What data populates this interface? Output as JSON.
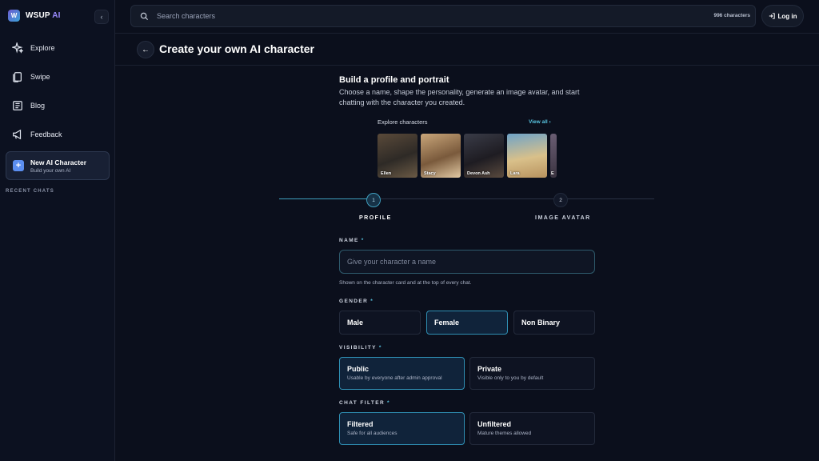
{
  "app": {
    "name": "WSUP",
    "name_accent": "AI",
    "logo_letter": "W"
  },
  "sidebar": {
    "items": [
      {
        "label": "Explore",
        "icon": "sparkle-icon"
      },
      {
        "label": "Swipe",
        "icon": "cards-icon"
      },
      {
        "label": "Blog",
        "icon": "newspaper-icon"
      },
      {
        "label": "Feedback",
        "icon": "megaphone-icon"
      }
    ],
    "new_character": {
      "title": "New AI Character",
      "subtitle": "Build your own AI"
    },
    "recent_chats_label": "RECENT CHATS"
  },
  "search": {
    "placeholder": "Search characters",
    "count": "996 characters"
  },
  "login": {
    "label": "Log in"
  },
  "page": {
    "title": "Create your own AI character"
  },
  "intro": {
    "title": "Build a profile and portrait",
    "description": "Choose a name, shape the personality, generate an image avatar, and start chatting with the character you created."
  },
  "explore": {
    "label": "Explore characters",
    "view_all": "View all",
    "characters": [
      "Ellen",
      "Stacy",
      "Devon Ash",
      "Lara",
      "E"
    ]
  },
  "steps": [
    {
      "number": "1",
      "label": "PROFILE",
      "active": true
    },
    {
      "number": "2",
      "label": "IMAGE AVATAR",
      "active": false
    }
  ],
  "form": {
    "name": {
      "label": "NAME",
      "required": "*",
      "placeholder": "Give your character a name",
      "hint": "Shown on the character card and at the top of every chat."
    },
    "gender": {
      "label": "GENDER",
      "required": "*",
      "options": [
        "Male",
        "Female",
        "Non Binary"
      ],
      "selected": "Female"
    },
    "visibility": {
      "label": "VISIBILITY",
      "required": "*",
      "options": [
        {
          "title": "Public",
          "subtitle": "Usable by everyone after admin approval"
        },
        {
          "title": "Private",
          "subtitle": "Visible only to you by default"
        }
      ],
      "selected": "Public"
    },
    "chat_filter": {
      "label": "CHAT FILTER",
      "required": "*",
      "options": [
        {
          "title": "Filtered",
          "subtitle": "Safe for all audiences"
        },
        {
          "title": "Unfiltered",
          "subtitle": "Mature themes allowed"
        }
      ],
      "selected": "Filtered"
    }
  },
  "colors": {
    "accent": "#58c4e0",
    "background": "#0b0f1c",
    "selected_border": "#2f8fb3"
  }
}
